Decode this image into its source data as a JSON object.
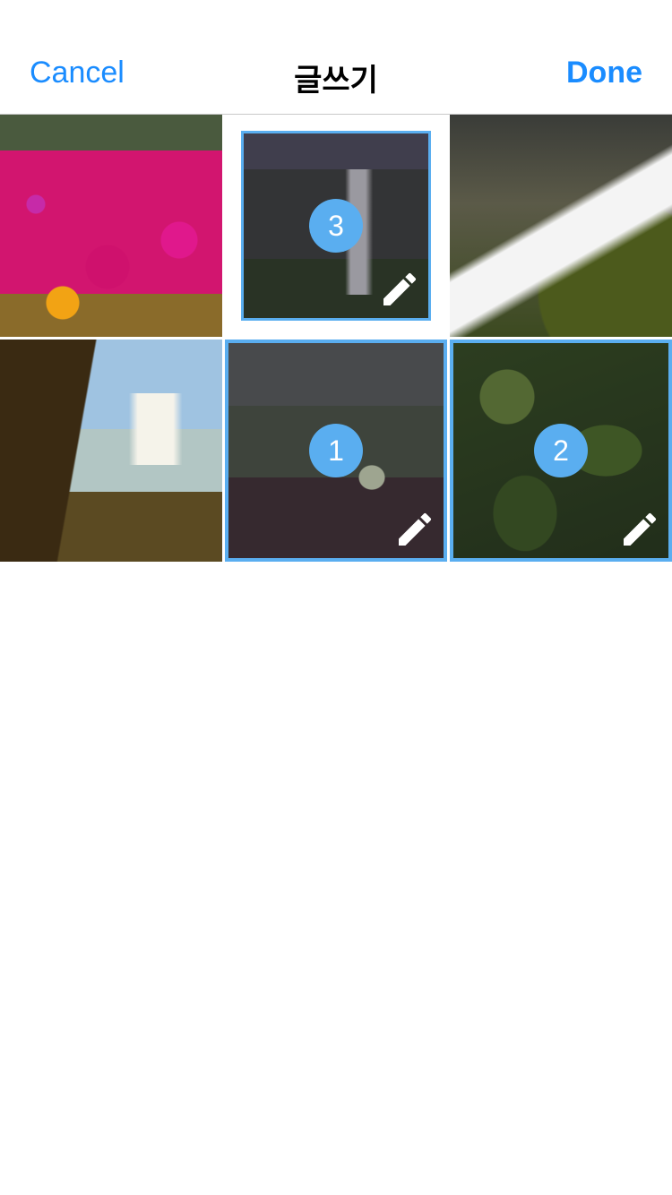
{
  "navbar": {
    "cancel_label": "Cancel",
    "title": "글쓰기",
    "done_label": "Done"
  },
  "accent_color": "#1a8cff",
  "selection_color": "#5aaef0",
  "photos": [
    {
      "id": "photo-flowers",
      "selected": false
    },
    {
      "id": "photo-waterfall-cliff",
      "selected": true,
      "order": "3",
      "edit_icon": "pencil-icon"
    },
    {
      "id": "photo-waterfall-rocks",
      "selected": false
    },
    {
      "id": "photo-waterfall-valley",
      "selected": false
    },
    {
      "id": "photo-grass",
      "selected": true,
      "order": "1",
      "edit_icon": "pencil-icon"
    },
    {
      "id": "photo-leaves",
      "selected": true,
      "order": "2",
      "edit_icon": "pencil-icon"
    }
  ]
}
